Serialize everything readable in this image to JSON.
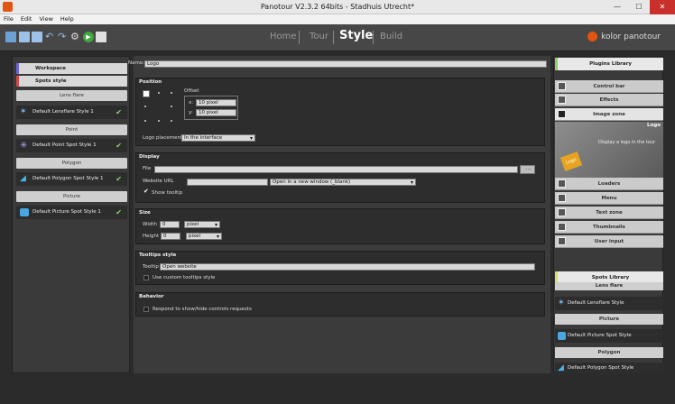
{
  "window": {
    "title": "Panotour V2.3.2 64bits - Stadhuis Utrecht*",
    "minimize": "—",
    "maximize": "☐",
    "close": "✕"
  },
  "menu": [
    "File",
    "Edit",
    "View",
    "Help"
  ],
  "nav": {
    "home": "Home",
    "tour": "Tour",
    "style": "Style",
    "build": "Build"
  },
  "brand": "kolor panotour",
  "left": {
    "workspace": "Workspace",
    "spots_style": "Spots style",
    "sections": [
      {
        "header": "Lens flare",
        "item": "Default Lensflare Style 1"
      },
      {
        "header": "Point",
        "item": "Default Point Spot Style 1"
      },
      {
        "header": "Polygon",
        "item": "Default Polygon Spot Style 1"
      },
      {
        "header": "Picture",
        "item": "Default Picture Spot Style 1"
      }
    ]
  },
  "center": {
    "name_label": "Name:",
    "name_value": "Logo",
    "position": {
      "header": "Position",
      "offset": "Offset",
      "x_label": "x:",
      "x_value": "10",
      "x_unit": "pixel",
      "y_label": "y:",
      "y_value": "10",
      "y_unit": "pixel",
      "logo_placement_label": "Logo placement",
      "logo_placement_value": "In the interface"
    },
    "display": {
      "header": "Display",
      "file_label": "File",
      "file_value": "",
      "browse": "...",
      "website_label": "Website URL",
      "website_value": "",
      "open_mode": "Open in a new window (_blank)",
      "show_tooltip": "Show tooltip"
    },
    "size": {
      "header": "Size",
      "width_label": "Width",
      "width_value": "0",
      "width_unit": "pixel",
      "height_label": "Height",
      "height_value": "0",
      "height_unit": "pixel"
    },
    "tooltips": {
      "header": "Tooltips style",
      "tooltip_label": "Tooltip",
      "tooltip_value": "Open website",
      "custom_style": "Use custom tooltips style"
    },
    "behavior": {
      "header": "Behavior",
      "respond": "Respond to show/hide controls requests"
    }
  },
  "right": {
    "plugins_library": "Plugins Library",
    "plugins": [
      "Control bar",
      "Effects",
      "Image zone"
    ],
    "logo_title": "Logo",
    "logo_desc": "Display a logo in the tour",
    "logo_badge": "Logo",
    "plugins2": [
      "Loaders",
      "Menu",
      "Text zone",
      "Thumbnails",
      "User input"
    ],
    "spots_library": "Spots Library",
    "spot_sections": [
      {
        "header": "Lens flare",
        "item": "Default Lensflare Style"
      },
      {
        "header": "Picture",
        "item": "Default Picture Spot Style"
      },
      {
        "header": "Polygon",
        "item": "Default Polygon Spot Style"
      }
    ]
  },
  "colors": {
    "accent": "#e25410",
    "check": "#8bd86e",
    "workspace_accent": "#6f66d6",
    "library_accent": "#8fd06a"
  }
}
